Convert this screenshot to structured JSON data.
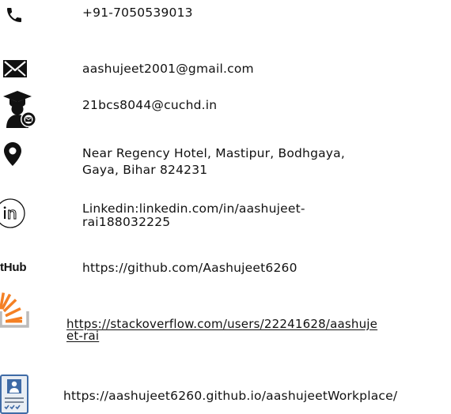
{
  "contacts": {
    "phone": "+91-7050539013",
    "email": "aashujeet2001@gmail.com",
    "college_email": "21bcs8044@cuchd.in",
    "address_line1": "Near Regency Hotel, Mastipur, Bodhgaya,",
    "address_line2": "Gaya, Bihar 824231",
    "linkedin_line1": "Linkedin:linkedin.com/in/aashujeet-",
    "linkedin_line2": "rai188032225",
    "github_logo_text": "itHub",
    "github_url": "https://github.com/Aashujeet6260",
    "stackoverflow_line1": "https://stackoverflow.com/users/22241628/aashuje",
    "stackoverflow_line2": "et-rai",
    "portfolio_url": "https://aashujeet6260.github.io/aashujeetWorkplace/"
  },
  "icons": {
    "phone": "phone-icon",
    "email": "envelope-icon",
    "college_email": "graduate-email-icon",
    "address": "location-pin-icon",
    "linkedin": "linkedin-icon",
    "github": "github-logo",
    "stackoverflow": "stackoverflow-icon",
    "portfolio": "resume-document-icon"
  },
  "colors": {
    "text": "#111111",
    "stackoverflow_orange": "#f48024",
    "stackoverflow_tray": "#bcbbbb",
    "resume_blue": "#3f6ba6"
  }
}
